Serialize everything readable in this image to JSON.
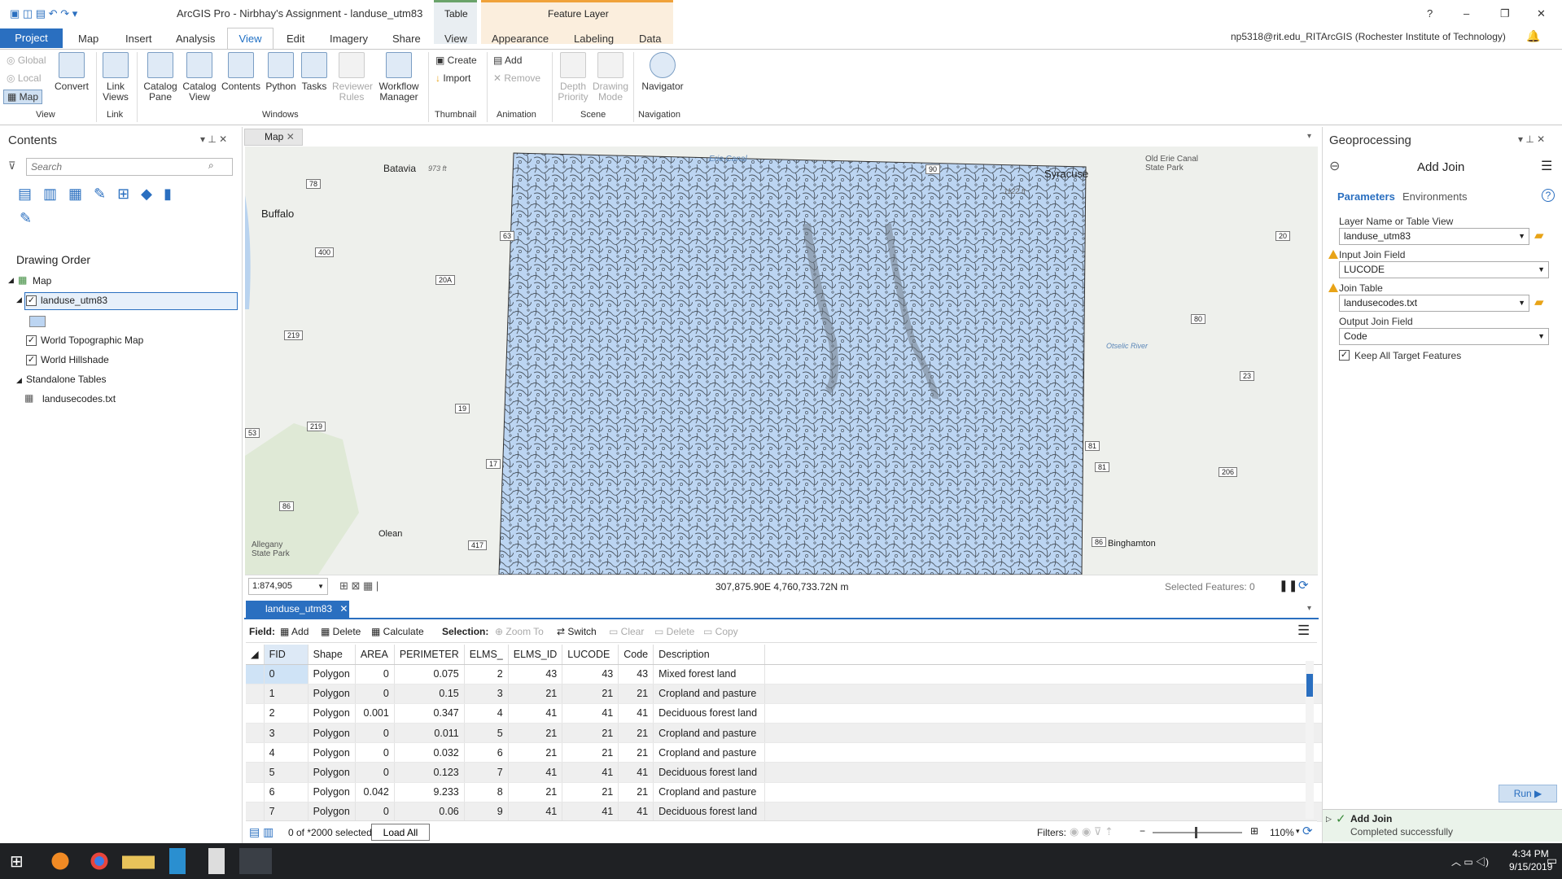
{
  "window": {
    "title": "ArcGIS Pro - Nirbhay's Assignment - landuse_utm83",
    "user": "np5318@rit.edu_RITArcGIS (Rochester Institute of Technology)",
    "help": "?",
    "minimize": "–",
    "restore": "❐",
    "close": "✕"
  },
  "context_tabs": {
    "table": "Table",
    "feature_layer": "Feature Layer"
  },
  "tabs": {
    "project": "Project",
    "map": "Map",
    "insert": "Insert",
    "analysis": "Analysis",
    "view": "View",
    "edit": "Edit",
    "imagery": "Imagery",
    "share": "Share",
    "ctx_view": "View",
    "appearance": "Appearance",
    "labeling": "Labeling",
    "data": "Data"
  },
  "ribbon": {
    "view_group": {
      "global": "Global",
      "local": "Local",
      "map": "Map",
      "convert": "Convert",
      "label": "View"
    },
    "link_group": {
      "link_views": "Link Views",
      "label": "Link"
    },
    "windows_group": {
      "catalog_pane": "Catalog Pane",
      "catalog_view": "Catalog View",
      "contents": "Contents",
      "python": "Python",
      "tasks": "Tasks",
      "reviewer_rules": "Reviewer Rules",
      "workflow_manager": "Workflow Manager",
      "label": "Windows"
    },
    "thumbnail_group": {
      "create": "Create",
      "import": "Import",
      "label": "Thumbnail"
    },
    "animation_group": {
      "add": "Add",
      "remove": "Remove",
      "label": "Animation"
    },
    "scene_group": {
      "depth_priority": "Depth Priority",
      "drawing_mode": "Drawing Mode",
      "label": "Scene"
    },
    "navigation_group": {
      "navigator": "Navigator",
      "label": "Navigation"
    }
  },
  "contents": {
    "title": "Contents",
    "search_placeholder": "Search",
    "drawing_order": "Drawing Order",
    "map": "Map",
    "layer": "landuse_utm83",
    "topo": "World Topographic Map",
    "hillshade": "World Hillshade",
    "standalone": "Standalone Tables",
    "table": "landusecodes.txt"
  },
  "map": {
    "tab": "Map",
    "scale": "1:874,905",
    "coords": "307,875.90E 4,760,733.72N m",
    "selected": "Selected Features: 0",
    "labels": {
      "batavia": "Batavia",
      "buffalo": "Buffalo",
      "syracuse": "Syracuse",
      "olean": "Olean",
      "binghamton": "Binghamton",
      "erie": "Erie Canal",
      "oldcanal": "Old Erie Canal State Park",
      "allegany": "Allegany State Park",
      "ft973": "973 ft",
      "ft1122": "1122 ft",
      "otselic": "Otselic River"
    },
    "shields": [
      "78",
      "90",
      "400",
      "20A",
      "219",
      "219",
      "19",
      "17",
      "86",
      "417",
      "20",
      "80",
      "23",
      "206",
      "81",
      "81",
      "86",
      "53",
      "63"
    ]
  },
  "table": {
    "tab": "landuse_utm83",
    "toolbar": {
      "field": "Field:",
      "add": "Add",
      "delete": "Delete",
      "calculate": "Calculate",
      "selection": "Selection:",
      "zoom": "Zoom To",
      "switch": "Switch",
      "clear": "Clear",
      "del2": "Delete",
      "copy": "Copy"
    },
    "columns": [
      "FID",
      "Shape",
      "AREA",
      "PERIMETER",
      "ELMS_",
      "ELMS_ID",
      "LUCODE",
      "Code",
      "Description"
    ],
    "rows": [
      [
        "0",
        "Polygon",
        "0",
        "0.075",
        "2",
        "43",
        "43",
        "43",
        "Mixed forest land"
      ],
      [
        "1",
        "Polygon",
        "0",
        "0.15",
        "3",
        "21",
        "21",
        "21",
        "Cropland and pasture"
      ],
      [
        "2",
        "Polygon",
        "0.001",
        "0.347",
        "4",
        "41",
        "41",
        "41",
        "Deciduous forest land"
      ],
      [
        "3",
        "Polygon",
        "0",
        "0.011",
        "5",
        "21",
        "21",
        "21",
        "Cropland and pasture"
      ],
      [
        "4",
        "Polygon",
        "0",
        "0.032",
        "6",
        "21",
        "21",
        "21",
        "Cropland and pasture"
      ],
      [
        "5",
        "Polygon",
        "0",
        "0.123",
        "7",
        "41",
        "41",
        "41",
        "Deciduous forest land"
      ],
      [
        "6",
        "Polygon",
        "0.042",
        "9.233",
        "8",
        "21",
        "21",
        "21",
        "Cropland and pasture"
      ],
      [
        "7",
        "Polygon",
        "0",
        "0.06",
        "9",
        "41",
        "41",
        "41",
        "Deciduous forest land"
      ]
    ],
    "status": "0 of *2000 selected",
    "load_all": "Load All",
    "filters": "Filters:",
    "zoom": "110%"
  },
  "geo": {
    "title": "Geoprocessing",
    "tool": "Add Join",
    "parameters": "Parameters",
    "environments": "Environments",
    "layer_label": "Layer Name or Table View",
    "layer_value": "landuse_utm83",
    "input_label": "Input Join Field",
    "input_value": "LUCODE",
    "join_label": "Join Table",
    "join_value": "landusecodes.txt",
    "output_label": "Output Join Field",
    "output_value": "Code",
    "keep": "Keep All Target Features",
    "run": "Run",
    "msg_title": "Add Join",
    "msg_sub": "Completed successfully"
  },
  "taskbar": {
    "time": "4:34 PM",
    "date": "9/15/2019"
  },
  "colors": {
    "accent": "#2a6fc0",
    "polygon": "#bcd5f2",
    "warn": "#e8a317"
  }
}
